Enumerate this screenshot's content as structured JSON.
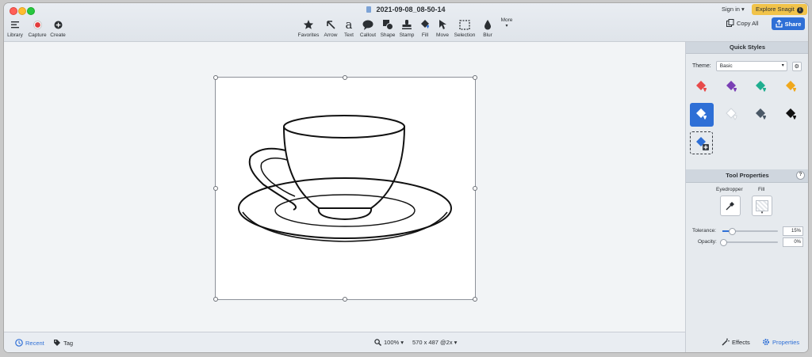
{
  "window": {
    "title": "2021-09-08_08-50-14"
  },
  "left_tools": [
    {
      "name": "library-button",
      "icon": "library-icon",
      "label": "Library"
    },
    {
      "name": "capture-button",
      "icon": "capture-icon",
      "label": "Capture"
    },
    {
      "name": "create-button",
      "icon": "create-icon",
      "label": "Create"
    }
  ],
  "toolbar": {
    "favorites": "Favorites",
    "arrow": "Arrow",
    "text": "Text",
    "callout": "Callout",
    "shape": "Shape",
    "stamp": "Stamp",
    "fill": "Fill",
    "move": "Move",
    "selection": "Selection",
    "blur": "Blur",
    "more": "More"
  },
  "header": {
    "sign_in": "Sign in ▾",
    "explore": "Explore Snagit",
    "copy_all": "Copy All",
    "share": "Share"
  },
  "quick_styles": {
    "title": "Quick Styles",
    "theme_label": "Theme:",
    "theme_value": "Basic",
    "colors": [
      "#e84a4a",
      "#7a3fb5",
      "#1fae8f",
      "#f0a81c",
      "#2e6fd6",
      "#ffffff",
      "#4a5866",
      "#111111"
    ]
  },
  "tool_properties": {
    "title": "Tool Properties",
    "eyedropper": "Eyedropper",
    "fill": "Fill",
    "tolerance_label": "Tolerance:",
    "tolerance_value": "15%",
    "tolerance": 0.15,
    "opacity_label": "Opacity:",
    "opacity_value": "0%",
    "opacity": 0
  },
  "status": {
    "recent": "Recent",
    "tag": "Tag",
    "zoom": "100% ▾",
    "dimensions": "570 x 487 @2x ▾",
    "effects": "Effects",
    "properties": "Properties"
  },
  "accent_color": "#2e6fd6"
}
